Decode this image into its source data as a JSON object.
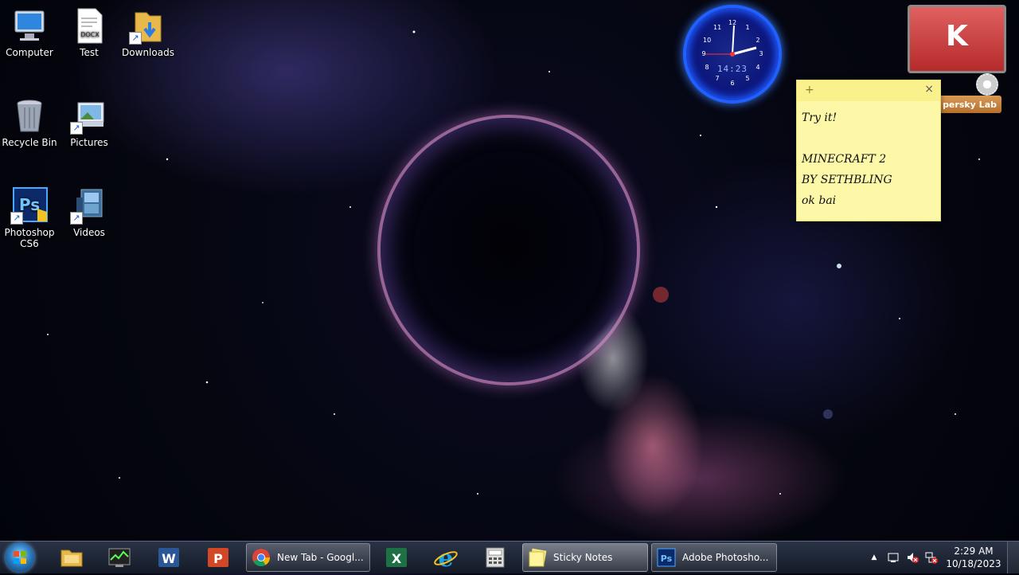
{
  "desktop": {
    "icons": [
      {
        "label": "Computer",
        "icon": "computer-icon"
      },
      {
        "label": "Test",
        "icon": "docx-file-icon",
        "badge": "DOCX"
      },
      {
        "label": "Downloads",
        "icon": "folder-shortcut-icon"
      },
      {
        "label": "Recycle Bin",
        "icon": "recycle-bin-icon"
      },
      {
        "label": "Pictures",
        "icon": "pictures-shortcut-icon"
      },
      {
        "label": "Photoshop CS6",
        "icon": "photoshop-icon",
        "badge": "Ps"
      },
      {
        "label": "Videos",
        "icon": "videos-shortcut-icon"
      }
    ]
  },
  "gadgets": {
    "clock": {
      "digital": "14:23",
      "numbers": [
        "12",
        "1",
        "2",
        "3",
        "4",
        "5",
        "6",
        "7",
        "8",
        "9",
        "10",
        "11"
      ]
    },
    "kaspersky": {
      "letter": "K",
      "label": "persky Lab"
    }
  },
  "sticky_note": {
    "plus": "+",
    "close": "×",
    "lines": [
      "Try it!",
      "",
      "MINECRAFT 2",
      "BY SETHBLING",
      "ok bai"
    ]
  },
  "taskbar": {
    "pinned": [
      {
        "name": "file-explorer-icon",
        "color": "#e8b84a"
      },
      {
        "name": "task-manager-icon",
        "color": "#6a7a5a"
      },
      {
        "name": "word-icon",
        "color": "#2b5797",
        "letter": "W"
      },
      {
        "name": "powerpoint-icon",
        "color": "#d24726",
        "letter": "P"
      },
      {
        "name": "excel-icon",
        "color": "#1e7145",
        "letter": "X"
      },
      {
        "name": "internet-explorer-icon",
        "color": "#1ba1e2",
        "letter": "e"
      },
      {
        "name": "calculator-icon",
        "color": "#dddddd"
      }
    ],
    "tasks": [
      {
        "label": "New Tab - Googl...",
        "icon": "chrome-icon"
      },
      {
        "label": "Sticky Notes",
        "icon": "sticky-notes-icon"
      },
      {
        "label": "Adobe Photosho...",
        "icon": "photoshop-icon",
        "letter": "Ps"
      }
    ],
    "tray": {
      "overflow": "▲",
      "time": "2:29 AM",
      "date": "10/18/2023"
    }
  }
}
